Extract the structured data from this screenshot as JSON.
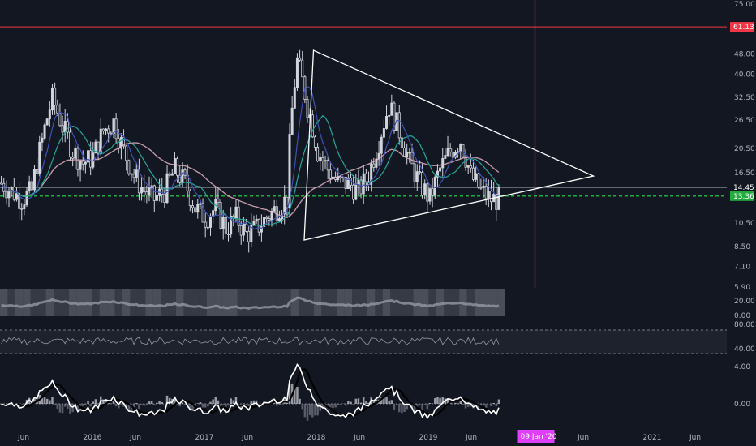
{
  "chart_data": {
    "type": "candlestick",
    "price_axis": {
      "scale": "log",
      "ticks": [
        "75.00",
        "48.00",
        "40.00",
        "32.50",
        "26.50",
        "20.50",
        "16.50",
        "10.50",
        "8.50",
        "7.10",
        "5.90"
      ],
      "tick_values": [
        75,
        48,
        40,
        32.5,
        26.5,
        20.5,
        16.5,
        10.5,
        8.5,
        7.1,
        5.9
      ],
      "range": [
        5.9,
        75
      ]
    },
    "price_tags": [
      {
        "label": "61.13",
        "value": 61.13,
        "color": "#f23645",
        "style": "solid"
      },
      {
        "label": "14.45",
        "value": 14.45,
        "color": "#b2b5be",
        "style": "solid"
      },
      {
        "label": "13.36",
        "value": 13.36,
        "color": "#22ab3f",
        "style": "dashed"
      }
    ],
    "time_axis": {
      "labels": [
        "Jun",
        "2016",
        "Jun",
        "2017",
        "Jun",
        "2018",
        "Jun",
        "2019",
        "Jun",
        "Jun",
        "2021",
        "Jun"
      ],
      "highlight_label": "09 Jan '20",
      "highlight_color": "#e040fb"
    },
    "annotations": {
      "triangle": {
        "points": [
          {
            "date": "2018-01",
            "price": 49.5
          },
          {
            "date": "2020-07",
            "price": 16.0
          },
          {
            "date": "2017-12",
            "price": 9.0
          }
        ],
        "color": "#ffffff"
      },
      "vertical_marker": {
        "date": "2020-01-09",
        "color": "#e0668f"
      }
    },
    "series": [
      {
        "name": "price",
        "approx_monthly_close": [
          15,
          14,
          13,
          14,
          22,
          32,
          25,
          20,
          18,
          19,
          24,
          26,
          20,
          16,
          14,
          13,
          14,
          17,
          15,
          12,
          11,
          12,
          10,
          11,
          9.5,
          10,
          11,
          12,
          13,
          45,
          30,
          20,
          17,
          15,
          15,
          14,
          16,
          22,
          30,
          24,
          18,
          15,
          13,
          17,
          20,
          22,
          16,
          14,
          13
        ]
      },
      {
        "name": "indicator-1",
        "range": [
          0,
          20
        ],
        "ticks": [
          "20.00",
          "0.00"
        ]
      },
      {
        "name": "indicator-2",
        "range": [
          20,
          100
        ],
        "ticks": [
          "80.00",
          "40.00"
        ]
      },
      {
        "name": "oscillator",
        "range": [
          -1,
          4
        ],
        "ticks": [
          "4.00",
          "0.00"
        ]
      }
    ],
    "colors": {
      "background": "#131722",
      "candle": "#d1d4dc",
      "ma_blue": "#3f51b5",
      "ma_teal": "#26a69a",
      "ma_pink": "#e8b8c8",
      "grid_line": "#787b86"
    }
  }
}
